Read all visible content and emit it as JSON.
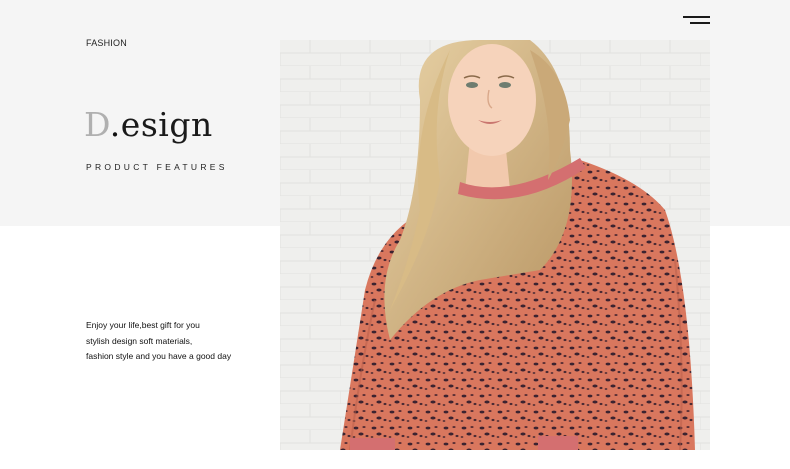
{
  "header": {
    "category": "FASHION",
    "menu_icon": "hamburger-menu-icon"
  },
  "hero": {
    "logo_initial": "D",
    "logo_dot": ".",
    "logo_rest": "esign",
    "subtitle": "PRODUCT FEATURES"
  },
  "description": {
    "lines": [
      "Enjoy your life,best gift for you",
      "stylish design soft materials,",
      "fashion style and you have a good day"
    ]
  },
  "colors": {
    "background": "#ffffff",
    "top_band": "#f5f5f5",
    "text": "#1a1a1a",
    "logo_initial": "#b0b0b0",
    "sweater": "#d9775e",
    "sweater_trim": "#d46f70"
  }
}
